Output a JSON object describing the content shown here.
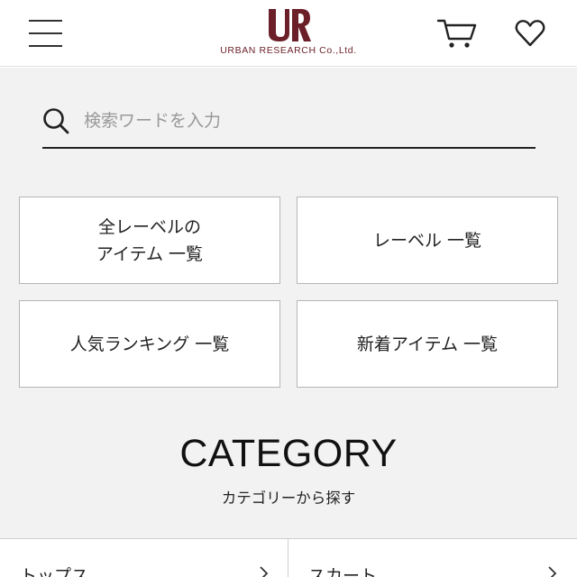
{
  "header": {
    "menu_icon": "hamburger-menu-icon",
    "logo_mark": "UR",
    "logo_text": "URBAN RESEARCH Co.,Ltd.",
    "brand_color": "#6b1f28",
    "cart_icon": "cart-icon",
    "favorite_icon": "heart-icon"
  },
  "search": {
    "placeholder": "検索ワードを入力",
    "value": ""
  },
  "nav": [
    {
      "label": "全レーベルの\nアイテム 一覧"
    },
    {
      "label": "レーベル 一覧"
    },
    {
      "label": "人気ランキング 一覧"
    },
    {
      "label": "新着アイテム 一覧"
    }
  ],
  "category": {
    "title": "CATEGORY",
    "subtitle": "カテゴリーから探す",
    "items": [
      {
        "label": "トップス"
      },
      {
        "label": "スカート"
      }
    ]
  }
}
